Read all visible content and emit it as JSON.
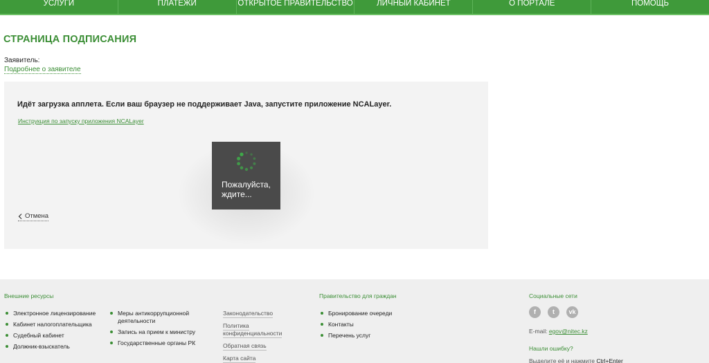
{
  "nav": {
    "items": [
      "Услуги",
      "Платежи",
      "Открытое правительство",
      "Личный кабинет",
      "О портале",
      "Помощь"
    ]
  },
  "page": {
    "title": "СТРАНИЦА ПОДПИСАНИЯ",
    "applicant_label": "Заявитель:",
    "applicant_link": "Подробнее о заявителе"
  },
  "panel": {
    "message": "Идёт загрузка апплета. Если ваш браузер не поддерживает Java, запустите приложение NCALayer.",
    "instruction_link": "Инструкция по запуску приложения NCALayer",
    "cancel_label": "Отмена",
    "cancel_icon": "chevron-left-icon"
  },
  "spinner": {
    "line1": "Пожалуйста,",
    "line2": "ждите...",
    "color": "#3fae49"
  },
  "footer": {
    "external": {
      "title": "Внешние ресурсы",
      "col1": [
        "Электронное лицензирование",
        "Кабинет налогоплательщика",
        "Судебный кабинет",
        "Должник-взыскатель"
      ],
      "col2": [
        "Меры антикоррупционной деятельности",
        "Запись на прием к министру",
        "Государственные органы РК"
      ]
    },
    "links": [
      "Законодательство",
      "Политика конфиденциальности",
      "Обратная связь",
      "Карта сайта"
    ],
    "gov": {
      "title": "Правительство для граждан",
      "items": [
        "Бронирование очереди",
        "Контакты",
        "Перечень услуг"
      ]
    },
    "social": {
      "title": "Социальные сети",
      "icons": [
        "facebook-icon",
        "twitter-icon",
        "vk-icon"
      ],
      "email_label": "E-mail:",
      "email": "egov@nitec.kz",
      "error_title": "Нашли ошибку?",
      "error_hint": "Выделите её и нажмите",
      "error_keys": "Ctrl+Enter"
    }
  },
  "colors": {
    "nav": "#3f9a3a",
    "accent": "#3b8e35",
    "panel": "#f3f3f3",
    "spinner_bg": "#4a4a4a"
  }
}
